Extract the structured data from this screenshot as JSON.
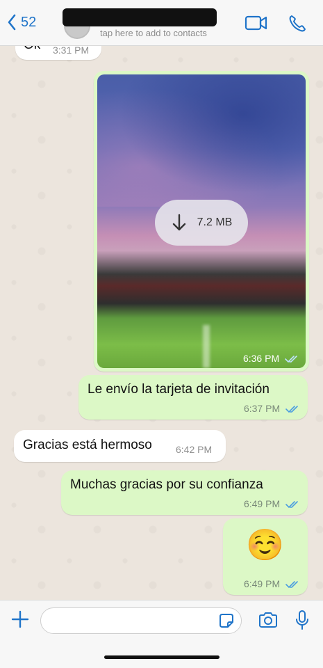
{
  "header": {
    "back_count": "52",
    "contact_subtitle": "tap here to add to contacts",
    "accent": "#1f74c9"
  },
  "messages": [
    {
      "type": "in",
      "text": "Ok",
      "time": "3:31 PM"
    },
    {
      "type": "out-image",
      "size": "7.2 MB",
      "time": "6:36 PM",
      "status": "read"
    },
    {
      "type": "out",
      "text": "Le envío la tarjeta de invitación",
      "time": "6:37 PM",
      "status": "read"
    },
    {
      "type": "in",
      "text": "Gracias está hermoso",
      "time": "6:42 PM"
    },
    {
      "type": "out",
      "text": "Muchas gracias por su confianza",
      "time": "6:49 PM",
      "status": "read"
    },
    {
      "type": "out-emoji",
      "text": "☺️",
      "time": "6:49 PM",
      "status": "read"
    }
  ],
  "input": {
    "placeholder": ""
  },
  "icons": [
    "chevron-left-icon",
    "video-call-icon",
    "phone-icon",
    "plus-icon",
    "sticker-icon",
    "camera-icon",
    "microphone-icon",
    "download-icon",
    "double-check-icon"
  ]
}
